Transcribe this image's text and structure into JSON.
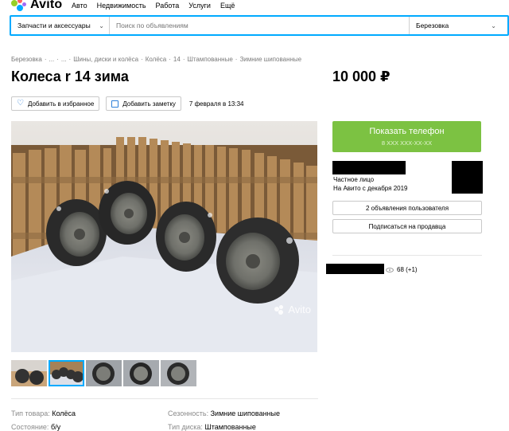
{
  "header": {
    "logo_text": "Avito",
    "nav": [
      "Авто",
      "Недвижимость",
      "Работа",
      "Услуги",
      "Ещё"
    ]
  },
  "search": {
    "category": "Запчасти и аксессуары",
    "placeholder": "Поиск по объявлениям",
    "city": "Березовка"
  },
  "breadcrumb": [
    "Березовка",
    "·",
    "...",
    "·",
    "...",
    "·",
    "Шины, диски и колёса",
    "·",
    "Колёса",
    "·",
    "14",
    "·",
    "Штампованные",
    "·",
    "Зимние шипованные"
  ],
  "listing": {
    "title": "Колеса r 14 зима",
    "price": "10 000 ₽",
    "favorite_label": "Добавить в избранное",
    "note_label": "Добавить заметку",
    "date": "7 февраля в 13:34",
    "watermark": "Avito"
  },
  "contact": {
    "show_phone": "Показать телефон",
    "phone_masked": "8 XXX XXX-XX-XX",
    "seller_type": "Частное лицо",
    "seller_since": "На Авито с декабря 2019",
    "user_ads": "2 объявления пользователя",
    "subscribe": "Подписаться на продавца",
    "views": "68 (+1)"
  },
  "params": {
    "type_label": "Тип товара:",
    "type_value": "Колёса",
    "season_label": "Сезонность:",
    "season_value": "Зимние шипованные",
    "condition_label": "Состояние:",
    "condition_value": "б/у",
    "disk_label": "Тип диска:",
    "disk_value": "Штампованные"
  },
  "colors": {
    "accent": "#00aaff",
    "phone_button": "#7cc242",
    "favorite_icon": "#2d7fd8"
  }
}
